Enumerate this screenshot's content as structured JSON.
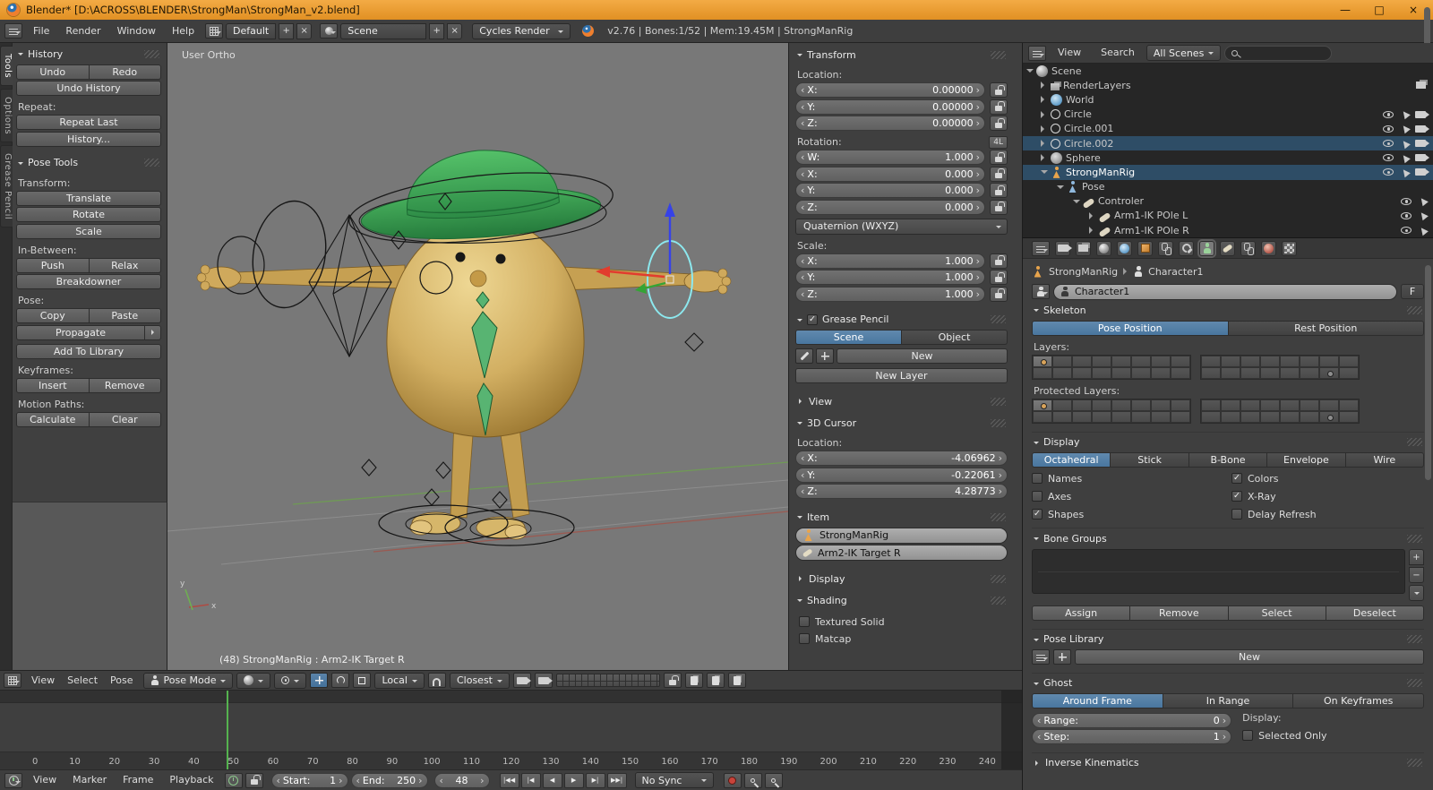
{
  "titlebar": {
    "title": "Blender* [D:\\ACROSS\\BLENDER\\StrongMan\\StrongMan_v2.blend]",
    "minimize": "—",
    "maximize": "□",
    "close": "×"
  },
  "menubar": {
    "menus": [
      "File",
      "Render",
      "Window",
      "Help"
    ],
    "layout_name": "Default",
    "scene_name": "Scene",
    "engine": "Cycles Render",
    "plus": "+",
    "unlink_x": "×",
    "stats": "v2.76 | Bones:1/52 | Mem:19.45M | StrongManRig"
  },
  "tool_shelf": {
    "tabs": [
      "Tools",
      "Options",
      "Grease Pencil"
    ],
    "history": {
      "title": "History",
      "undo": "Undo",
      "redo": "Redo",
      "undo_history": "Undo History",
      "repeat_label": "Repeat:",
      "repeat_last": "Repeat Last",
      "history_menu": "History..."
    },
    "pose_tools": {
      "title": "Pose Tools",
      "transform_label": "Transform:",
      "translate": "Translate",
      "rotate": "Rotate",
      "scale": "Scale",
      "inbetween_label": "In-Between:",
      "push": "Push",
      "relax": "Relax",
      "breakdowner": "Breakdowner",
      "pose_label": "Pose:",
      "copy": "Copy",
      "paste": "Paste",
      "propagate": "Propagate",
      "add_to_library": "Add To Library",
      "keyframes_label": "Keyframes:",
      "insert": "Insert",
      "remove": "Remove",
      "motion_paths_label": "Motion Paths:",
      "calculate": "Calculate",
      "clear": "Clear"
    }
  },
  "viewport": {
    "view_label": "User Ortho",
    "active_label": "(48) StrongManRig : Arm2-IK Target R",
    "axis_x": "x",
    "axis_y": "y",
    "header": {
      "menus": [
        "View",
        "Select",
        "Pose"
      ],
      "mode": "Pose Mode",
      "orientation": "Local",
      "snap_target": "Closest"
    }
  },
  "npanel": {
    "transform": {
      "title": "Transform",
      "location_label": "Location:",
      "location": [
        {
          "axis": "X:",
          "value": "0.00000"
        },
        {
          "axis": "Y:",
          "value": "0.00000"
        },
        {
          "axis": "Z:",
          "value": "0.00000"
        }
      ],
      "rotation_label": "Rotation:",
      "rotation_badge": "4L",
      "rotation": [
        {
          "axis": "W:",
          "value": "1.000"
        },
        {
          "axis": "X:",
          "value": "0.000"
        },
        {
          "axis": "Y:",
          "value": "0.000"
        },
        {
          "axis": "Z:",
          "value": "0.000"
        }
      ],
      "rotation_mode": "Quaternion (WXYZ)",
      "scale_label": "Scale:",
      "scale": [
        {
          "axis": "X:",
          "value": "1.000"
        },
        {
          "axis": "Y:",
          "value": "1.000"
        },
        {
          "axis": "Z:",
          "value": "1.000"
        }
      ]
    },
    "grease_pencil": {
      "title": "Grease Pencil",
      "scene_btn": "Scene",
      "object_btn": "Object",
      "new_btn": "New",
      "new_layer_btn": "New Layer"
    },
    "view": {
      "title": "View"
    },
    "cursor3d": {
      "title": "3D Cursor",
      "location_label": "Location:",
      "location": [
        {
          "axis": "X:",
          "value": "-4.06962"
        },
        {
          "axis": "Y:",
          "value": "-0.22061"
        },
        {
          "axis": "Z:",
          "value": "4.28773"
        }
      ]
    },
    "item": {
      "title": "Item",
      "object_name": "StrongManRig",
      "bone_name": "Arm2-IK Target R"
    },
    "display": {
      "title": "Display"
    },
    "shading": {
      "title": "Shading",
      "textured_solid": "Textured Solid",
      "matcap": "Matcap"
    }
  },
  "outliner": {
    "header": {
      "view": "View",
      "search": "Search",
      "scope": "All Scenes"
    },
    "rows": [
      {
        "label": "Scene"
      },
      {
        "label": "RenderLayers"
      },
      {
        "label": "World"
      },
      {
        "label": "Circle"
      },
      {
        "label": "Circle.001"
      },
      {
        "label": "Circle.002"
      },
      {
        "label": "Sphere"
      },
      {
        "label": "StrongManRig"
      },
      {
        "label": "Pose"
      },
      {
        "label": "Controler"
      },
      {
        "label": "Arm1-IK POle L"
      },
      {
        "label": "Arm1-IK POle R"
      }
    ]
  },
  "properties": {
    "breadcrumb": {
      "object": "StrongManRig",
      "data": "Character1"
    },
    "name_value": "Character1",
    "fake_user": "F",
    "skeleton": {
      "title": "Skeleton",
      "pose_position": "Pose Position",
      "rest_position": "Rest Position",
      "layers_label": "Layers:",
      "protected_label": "Protected Layers:",
      "layers_left": [
        "a",
        "",
        "",
        "",
        "",
        "",
        "",
        "",
        "",
        "",
        "",
        "",
        "",
        "",
        "",
        ""
      ],
      "layers_right": [
        "",
        "",
        "",
        "",
        "",
        "",
        "",
        "",
        "",
        "",
        "",
        "",
        "",
        "",
        "d",
        ""
      ],
      "protected_left": [
        "a",
        "",
        "",
        "",
        "",
        "",
        "",
        "",
        "",
        "",
        "",
        "",
        "",
        "",
        "",
        ""
      ],
      "protected_right": [
        "",
        "",
        "",
        "",
        "",
        "",
        "",
        "",
        "",
        "",
        "",
        "",
        "",
        "",
        "d",
        ""
      ]
    },
    "display": {
      "title": "Display",
      "octahedral": "Octahedral",
      "stick": "Stick",
      "bbone": "B-Bone",
      "envelope": "Envelope",
      "wire": "Wire",
      "names": "Names",
      "axes": "Axes",
      "shapes": "Shapes",
      "colors": "Colors",
      "xray": "X-Ray",
      "delay_refresh": "Delay Refresh"
    },
    "bone_groups": {
      "title": "Bone Groups",
      "plus": "+",
      "minus": "−",
      "assign": "Assign",
      "remove": "Remove",
      "select": "Select",
      "deselect": "Deselect"
    },
    "pose_library": {
      "title": "Pose Library",
      "new_btn": "New"
    },
    "ghost": {
      "title": "Ghost",
      "around_frame": "Around Frame",
      "in_range": "In Range",
      "on_keyframes": "On Keyframes",
      "range_label": "Range:",
      "range_value": "0",
      "step_label": "Step:",
      "step_value": "1",
      "display_label": "Display:",
      "selected_only": "Selected Only"
    },
    "ik": {
      "title": "Inverse Kinematics"
    }
  },
  "timeline": {
    "header": {
      "menus": [
        "View",
        "Marker",
        "Frame",
        "Playback"
      ],
      "start_label": "Start:",
      "start_value": "1",
      "end_label": "End:",
      "end_value": "250",
      "current_frame": "48",
      "sync_mode": "No Sync"
    },
    "transport": [
      "|◀◀",
      "|◀",
      "◀",
      "▶",
      "▶|",
      "▶▶|"
    ],
    "ticks": [
      "0",
      "10",
      "20",
      "30",
      "40",
      "50",
      "60",
      "70",
      "80",
      "90",
      "100",
      "110",
      "120",
      "130",
      "140",
      "150",
      "160",
      "170",
      "180",
      "190",
      "200",
      "210",
      "220",
      "230",
      "240"
    ]
  },
  "icons": {
    "blender-logo": "css-orange-blue-circle",
    "search-icon": "css-magnifier",
    "magnet-icon": "css-magnet",
    "eye-icon": "css-eye",
    "camera-icon": "css-camera",
    "lock-icon": "css-padlock",
    "record-icon": "css-red-dot",
    "clock-icon": "css-clock",
    "person-icon": "css-person",
    "grid-icon": "css-grid"
  }
}
